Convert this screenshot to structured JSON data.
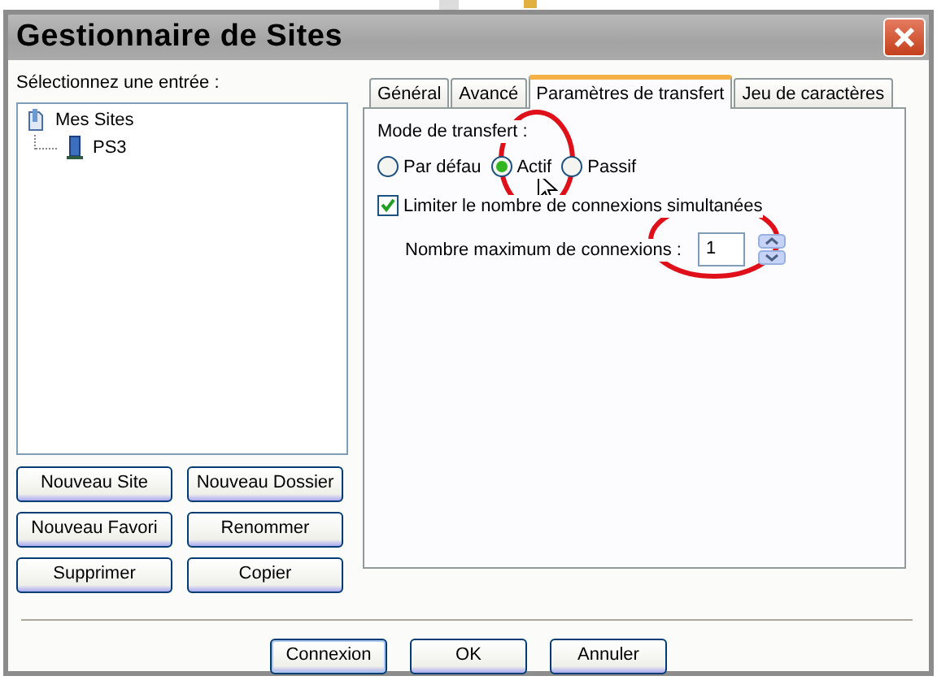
{
  "window": {
    "title": "Gestionnaire de Sites"
  },
  "site_list": {
    "label": "Sélectionnez une entrée :",
    "tree": [
      {
        "label": "Mes Sites",
        "selected": false,
        "children": [
          {
            "label": "PS3",
            "selected": false
          }
        ]
      }
    ]
  },
  "site_buttons": [
    "Nouveau Site",
    "Nouveau Dossier",
    "Nouveau Favori",
    "Renommer",
    "Supprimer",
    "Copier"
  ],
  "tabs": [
    {
      "label": "Général",
      "selected": false
    },
    {
      "label": "Avancé",
      "selected": false
    },
    {
      "label": "Paramètres de transfert",
      "selected": true
    },
    {
      "label": "Jeu de caractères",
      "selected": false
    }
  ],
  "transfer": {
    "mode_label": "Mode de transfert :",
    "modes": [
      {
        "label": "Par défau",
        "selected": false
      },
      {
        "label": "Actif",
        "selected": true
      },
      {
        "label": "Passif",
        "selected": false
      }
    ],
    "limit": {
      "label": "Limiter le nombre de connexions simultanées",
      "checked": true
    },
    "max_connections": {
      "label": "Nombre maximum de connexions :",
      "value": "1"
    }
  },
  "footer_buttons": [
    {
      "label": "Connexion",
      "default": true
    },
    {
      "label": "OK",
      "default": false
    },
    {
      "label": "Annuler",
      "default": false
    }
  ]
}
